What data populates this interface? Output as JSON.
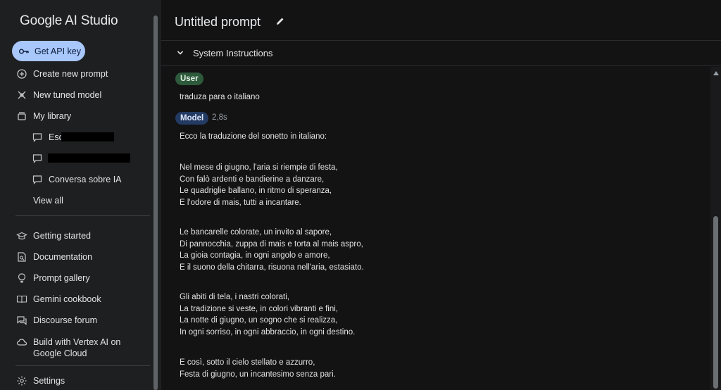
{
  "app": {
    "brand": "Google AI Studio"
  },
  "sidebar": {
    "api_button": "Get API key",
    "create_prompt": "Create new prompt",
    "new_tuned_model": "New tuned model",
    "my_library": "My library",
    "library_items": [
      {
        "label": "Escr",
        "redacted": true
      },
      {
        "label": "",
        "redacted": true
      },
      {
        "label": "Conversa sobre IA",
        "redacted": false
      }
    ],
    "view_all": "View all",
    "resources": [
      {
        "label": "Getting started",
        "icon": "graduation-cap-icon"
      },
      {
        "label": "Documentation",
        "icon": "doc-search-icon"
      },
      {
        "label": "Prompt gallery",
        "icon": "bulb-icon"
      },
      {
        "label": "Gemini cookbook",
        "icon": "book-icon"
      },
      {
        "label": "Discourse forum",
        "icon": "forum-icon"
      }
    ],
    "vertex_line1": "Build with Vertex AI on",
    "vertex_line2": "Google Cloud",
    "settings": "Settings"
  },
  "header": {
    "title": "Untitled prompt"
  },
  "system_instructions": {
    "label": "System Instructions"
  },
  "chat": {
    "user_role": "User",
    "user_message": "traduza para o italiano",
    "model_role": "Model",
    "model_time": "2,8s",
    "model_lines": [
      "Ecco la traduzione del sonetto in italiano:",
      "Nel mese di giugno, l'aria si riempie di festa,",
      "Con falò ardenti e bandierine a danzare,",
      "Le quadriglie ballano, in ritmo di speranza,",
      "E l'odore di mais, tutti a incantare.",
      "Le bancarelle colorate, un invito al sapore,",
      "Di pannocchia, zuppa di mais e torta al mais aspro,",
      "La gioia contagia, in ogni angolo e amore,",
      "E il suono della chitarra, risuona nell'aria, estasiato.",
      "Gli abiti di tela, i nastri colorati,",
      "La tradizione si veste, in colori vibranti e fini,",
      "La notte di giugno, un sogno che si realizza,",
      "In ogni sorriso, in ogni abbraccio, in ogni destino.",
      "E così, sotto il cielo stellato e azzurro,",
      "Festa di giugno, un incantesimo senza pari."
    ]
  },
  "colors": {
    "sidebar_bg": "#1e1f20",
    "main_bg": "#131314",
    "api_button_bg": "#a8c7fa",
    "user_chip_bg": "#2e5a3c",
    "model_chip_bg": "#233a63"
  }
}
